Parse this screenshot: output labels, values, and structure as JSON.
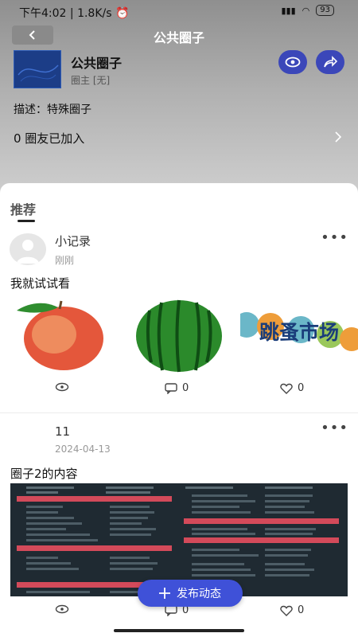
{
  "status": {
    "time": "下午4:02",
    "speed": "1.8K/s",
    "battery": "93"
  },
  "nav": {
    "title": "公共圈子"
  },
  "circle": {
    "name": "公共圈子",
    "owner": "圈主 [无]",
    "description": "描述：特殊圈子",
    "members": "0 圈友已加入"
  },
  "tabs": {
    "recommend": "推荐"
  },
  "posts": [
    {
      "user": "小记录",
      "time": "刚刚",
      "text": "我就试试看",
      "comments": "0",
      "likes": "0",
      "images": [
        "peach",
        "watermelon",
        "flea-market-text"
      ],
      "image_text": "跳蚤市场"
    },
    {
      "user": "11",
      "time": "2024-04-13",
      "text": "圈子2的内容",
      "comments": "0",
      "likes": "0",
      "images": [
        "git-cheatsheet"
      ]
    }
  ],
  "publish_label": "发布动态",
  "colors": {
    "accent": "#3f51d8",
    "circle_button": "#3b47b9"
  },
  "icons": [
    "back-icon",
    "eye-icon",
    "share-icon",
    "chevron-right-icon",
    "more-icon",
    "view-icon",
    "comment-icon",
    "like-icon",
    "plus-icon"
  ]
}
